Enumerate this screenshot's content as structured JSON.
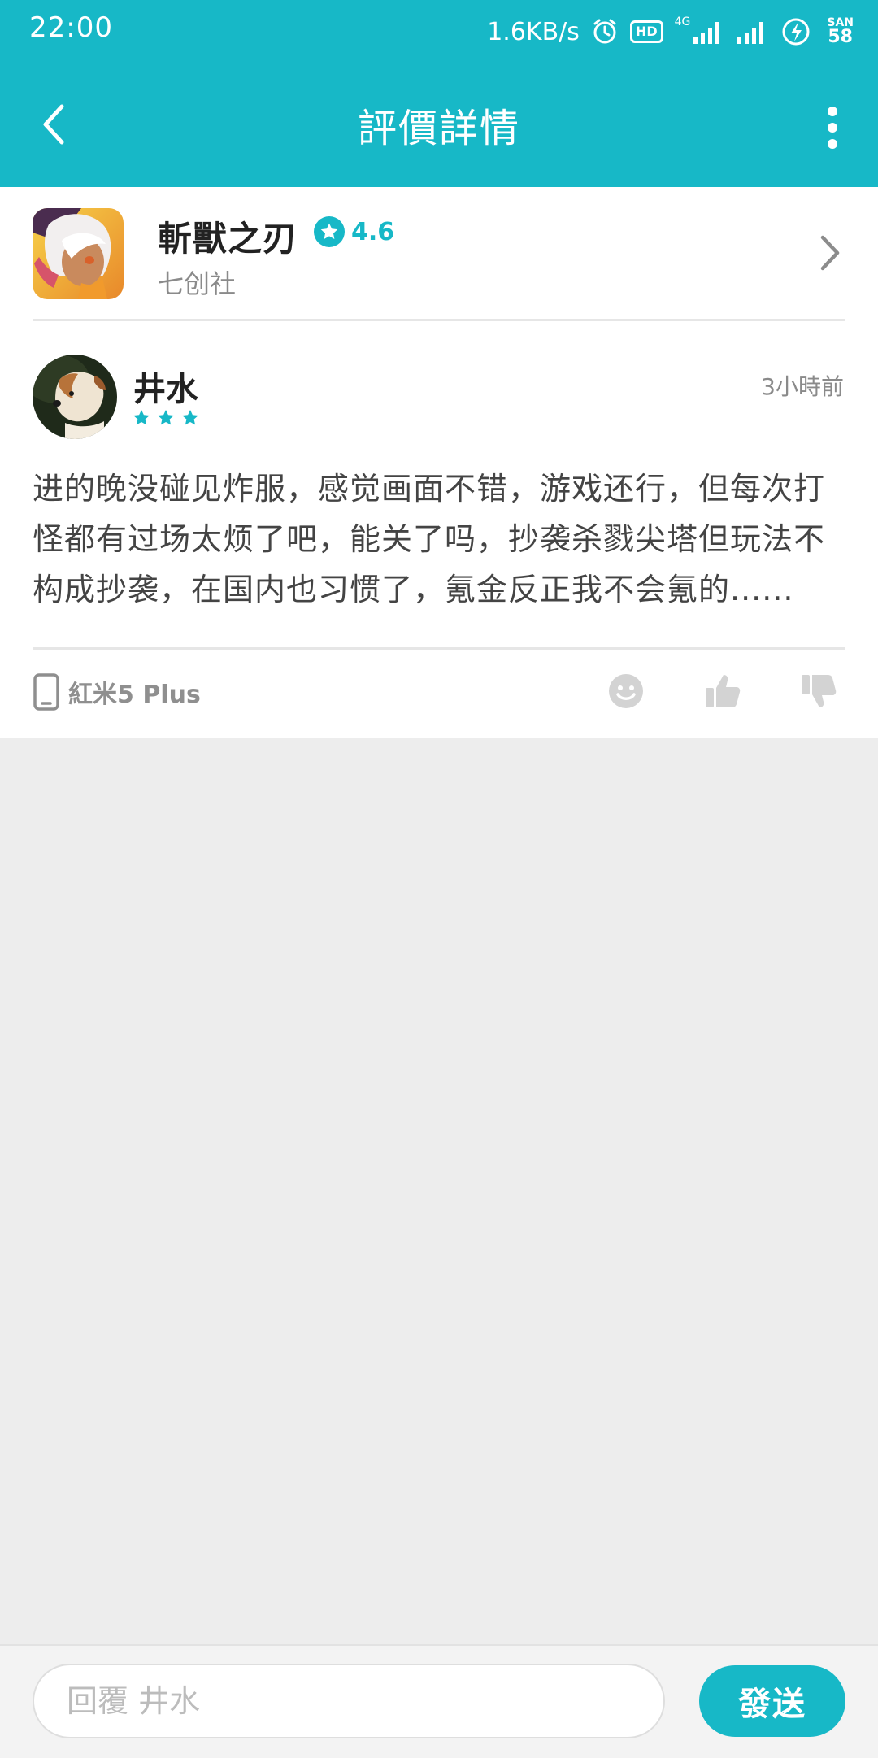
{
  "status_bar": {
    "time": "22:00",
    "network_speed": "1.6KB/s",
    "hd_label": "HD",
    "network_type": "4G",
    "battery_label": "SAN",
    "battery_level": "58",
    "icons": [
      "alarm-icon",
      "hd-icon",
      "signal-4g-icon",
      "signal-icon",
      "battery-charging-icon"
    ]
  },
  "header": {
    "title": "評價詳情",
    "icons": [
      "back-arrow-icon",
      "more-vertical-icon"
    ]
  },
  "game": {
    "name": "斬獸之刃",
    "rating": "4.6",
    "developer": "七创社",
    "icons": [
      "star-circle-icon",
      "chevron-right-icon"
    ]
  },
  "review": {
    "user_name": "井水",
    "star_count": 3,
    "time_ago": "3小時前",
    "text": "进的晚没碰见炸服，感觉画面不错，游戏还行，但每次打怪都有过场太烦了吧，能关了吗，抄袭杀戮尖塔但玩法不构成抄袭，在国内也习惯了，氪金反正我不会氪的......",
    "device": "紅米5 Plus",
    "icons": [
      "phone-icon",
      "emoji-icon",
      "thumb-up-icon",
      "thumb-down-icon"
    ]
  },
  "reply": {
    "placeholder": "回覆 井水",
    "send_label": "發送"
  },
  "colors": {
    "accent": "#17b8c7",
    "background": "#ededed",
    "card": "#ffffff",
    "muted_text": "#8a8a8a"
  }
}
